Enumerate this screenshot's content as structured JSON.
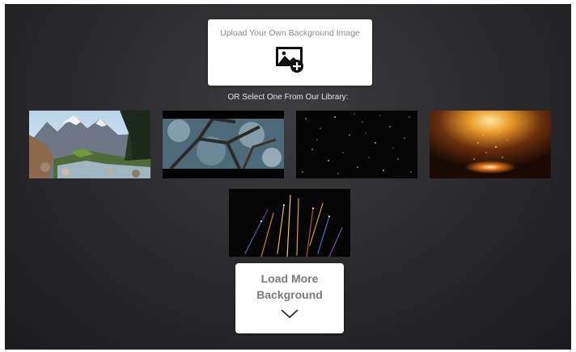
{
  "upload": {
    "label": "Upload Your Own Background Image",
    "icon": "image-add-icon"
  },
  "library": {
    "label": "OR Select One From Our Library:",
    "thumbnails": [
      {
        "subject": "mountain-river"
      },
      {
        "subject": "icy-branches"
      },
      {
        "subject": "dark-starfield"
      },
      {
        "subject": "golden-light-particles"
      },
      {
        "subject": "light-streaks"
      }
    ]
  },
  "load_more": {
    "label": "Load More\nBackground",
    "icon": "chevron-down-icon"
  },
  "colors": {
    "background": "#2c2c2f",
    "card": "#ffffff",
    "muted_text": "#8a8a8a",
    "button_text": "#7a7a7a"
  }
}
